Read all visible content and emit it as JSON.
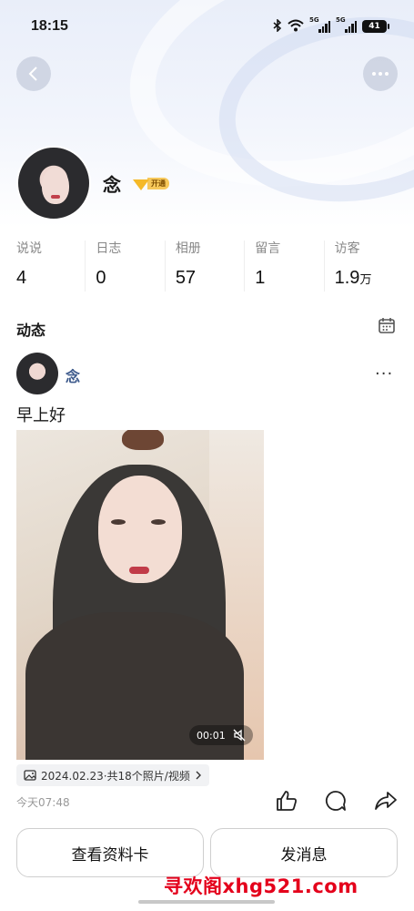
{
  "status_bar": {
    "time": "18:15",
    "signal1": "5G",
    "signal2": "5G",
    "battery": "41"
  },
  "profile": {
    "name": "念",
    "vip_badge": "开通"
  },
  "stats": [
    {
      "label": "说说",
      "value": "4",
      "unit": ""
    },
    {
      "label": "日志",
      "value": "0",
      "unit": ""
    },
    {
      "label": "相册",
      "value": "57",
      "unit": ""
    },
    {
      "label": "留言",
      "value": "1",
      "unit": ""
    },
    {
      "label": "访客",
      "value": "1.9",
      "unit": "万"
    }
  ],
  "feed": {
    "title": "动态",
    "post": {
      "author": "念",
      "text": "早上好",
      "video_time": "00:01",
      "album_info": "2024.02.23·共18个照片/视频",
      "time": "今天07:48"
    }
  },
  "buttons": {
    "profile_card": "查看资料卡",
    "send_message": "发消息"
  },
  "watermark": "寻欢阁xhg521.com",
  "colors": {
    "author_name": "#3d5a8c",
    "vip_gold": "#f5b928",
    "watermark_red": "#e4001b"
  },
  "icons": [
    "back-icon",
    "more-icon",
    "calendar-icon",
    "like-icon",
    "comment-icon",
    "share-icon",
    "mute-icon",
    "photo-icon"
  ]
}
